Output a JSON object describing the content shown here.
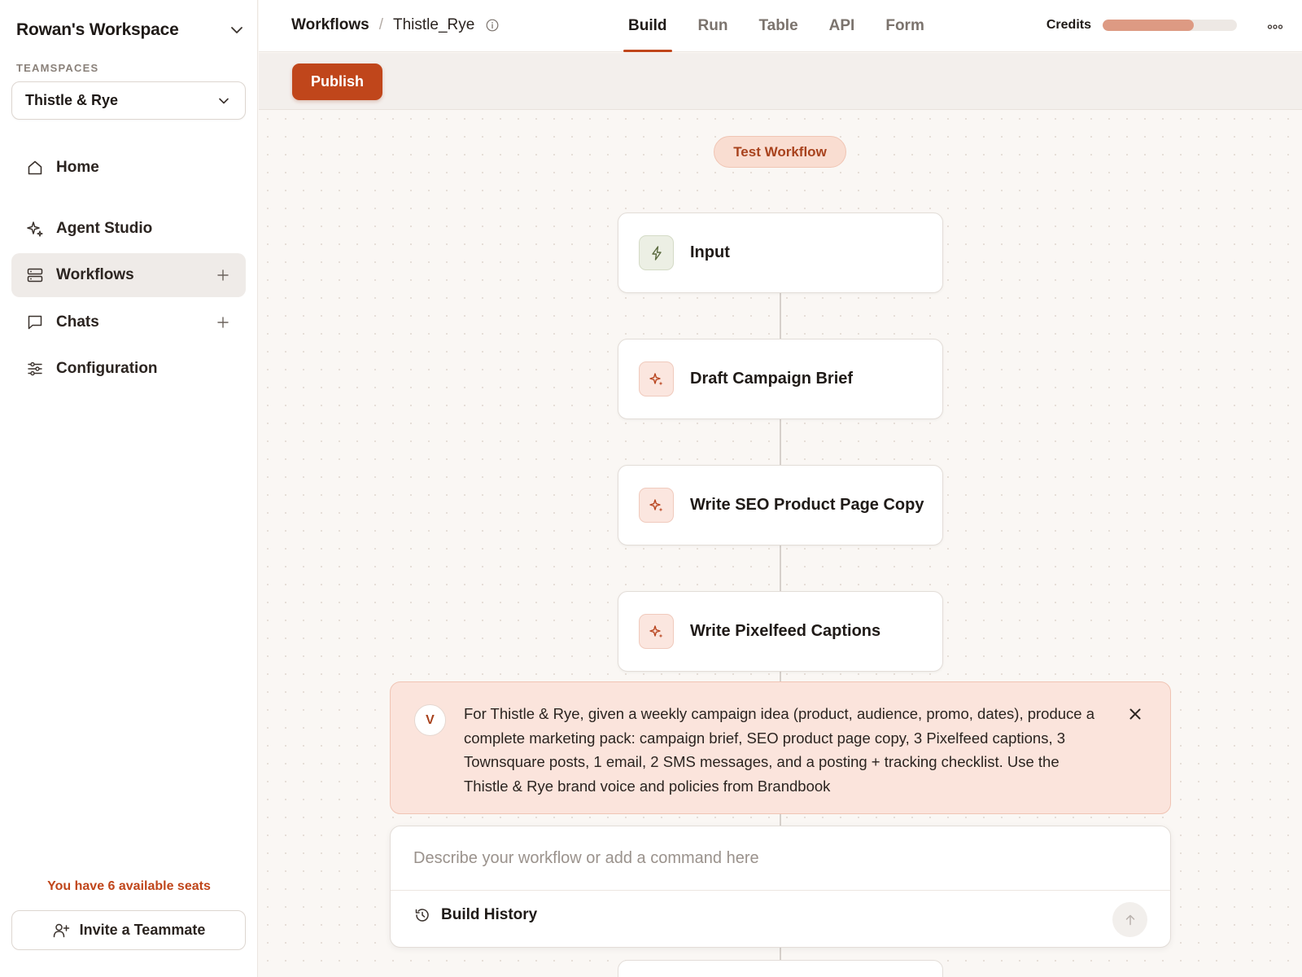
{
  "workspace": {
    "name": "Rowan's Workspace"
  },
  "teamspaces": {
    "label": "TEAMSPACES",
    "selected": "Thistle & Rye"
  },
  "nav": {
    "items": [
      {
        "label": "Home",
        "icon": "home-icon"
      },
      {
        "label": "Agent Studio",
        "icon": "sparkle-icon"
      },
      {
        "label": "Workflows",
        "icon": "server-icon",
        "active": true
      },
      {
        "label": "Chats",
        "icon": "chat-icon"
      },
      {
        "label": "Configuration",
        "icon": "sliders-icon"
      }
    ]
  },
  "seats": {
    "text": "You have 6 available seats"
  },
  "invite": {
    "label": "Invite a Teammate"
  },
  "breadcrumb": {
    "root": "Workflows",
    "separator": "/",
    "current": "Thistle_Rye"
  },
  "tabs": [
    "Build",
    "Run",
    "Table",
    "API",
    "Form"
  ],
  "active_tab": "Build",
  "credits": {
    "label": "Credits",
    "used_fraction": 0.68
  },
  "toolbar": {
    "publish_label": "Publish"
  },
  "canvas": {
    "test_label": "Test Workflow",
    "nodes": [
      {
        "title": "Input",
        "kind": "input"
      },
      {
        "title": "Draft Campaign Brief",
        "kind": "ai"
      },
      {
        "title": "Write SEO Product Page Copy",
        "kind": "ai"
      },
      {
        "title": "Write Pixelfeed Captions",
        "kind": "ai"
      }
    ]
  },
  "prompt": {
    "avatar_initial": "V",
    "text": "For Thistle & Rye, given a weekly campaign idea (product, audience, promo, dates), produce a complete marketing pack: campaign brief, SEO product page copy, 3 Pixelfeed captions, 3 Townsquare posts, 1 email, 2 SMS messages, and a posting + tracking checklist. Use the Thistle & Rye brand voice and policies from Brandbook"
  },
  "composer": {
    "placeholder": "Describe your workflow or add a command here",
    "history_label": "Build History"
  },
  "colors": {
    "accent": "#c0461b",
    "credits_fill": "#dd9a83",
    "prompt_bg": "#fbe4dc",
    "seats_text": "#c0461b"
  }
}
